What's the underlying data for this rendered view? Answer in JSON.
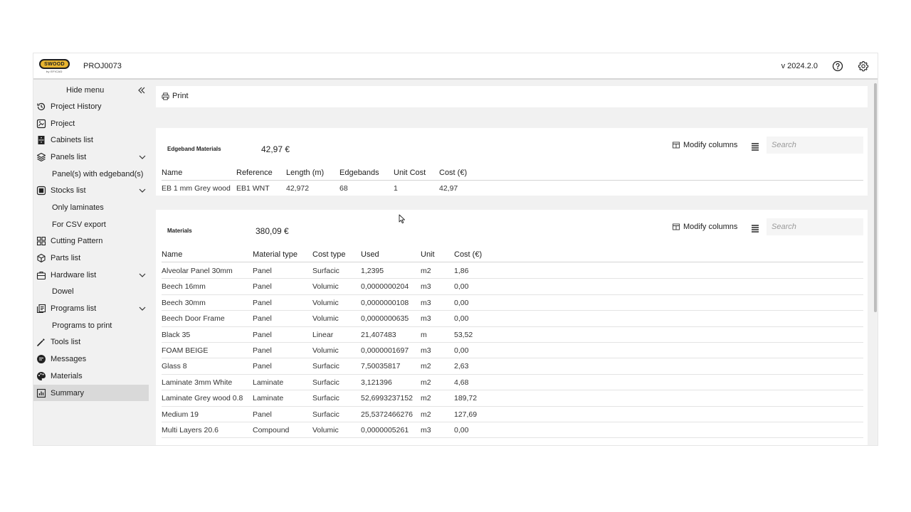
{
  "header": {
    "logo_text": "SWOOD",
    "logo_sub": "by EFICAD",
    "project_code": "PROJ0073",
    "version": "v 2024.2.0",
    "help_icon": "help-circle-icon",
    "settings_icon": "gear-icon"
  },
  "sidebar": {
    "hide_menu_label": "Hide menu",
    "items": [
      {
        "label": "Project History",
        "icon": "history-icon",
        "sub": false
      },
      {
        "label": "Project",
        "icon": "project-icon",
        "sub": false
      },
      {
        "label": "Cabinets list",
        "icon": "cabinet-icon",
        "sub": false
      },
      {
        "label": "Panels list",
        "icon": "layers-icon",
        "sub": false,
        "expandable": true
      },
      {
        "label": "Panel(s) with edgeband(s)",
        "sub": true
      },
      {
        "label": "Stocks list",
        "icon": "stock-icon",
        "sub": false,
        "expandable": true
      },
      {
        "label": "Only laminates",
        "sub": true
      },
      {
        "label": "For CSV export",
        "sub": true
      },
      {
        "label": "Cutting Pattern",
        "icon": "grid-icon",
        "sub": false
      },
      {
        "label": "Parts list",
        "icon": "cube-icon",
        "sub": false
      },
      {
        "label": "Hardware list",
        "icon": "toolbox-icon",
        "sub": false,
        "expandable": true
      },
      {
        "label": "Dowel",
        "sub": true
      },
      {
        "label": "Programs list",
        "icon": "programs-icon",
        "sub": false,
        "expandable": true
      },
      {
        "label": "Programs to print",
        "sub": true
      },
      {
        "label": "Tools list",
        "icon": "tool-icon",
        "sub": false
      },
      {
        "label": "Messages",
        "icon": "message-icon",
        "sub": false
      },
      {
        "label": "Materials",
        "icon": "palette-icon",
        "sub": false
      },
      {
        "label": "Summary",
        "icon": "chart-icon",
        "sub": false,
        "active": true
      }
    ]
  },
  "toolbar": {
    "print_label": "Print"
  },
  "edgeband": {
    "title": "Edgeband Materials",
    "total": "42,97 €",
    "modify_columns": "Modify columns",
    "search_placeholder": "Search",
    "columns": [
      "Name",
      "Reference",
      "Length (m)",
      "Edgebands",
      "Unit Cost",
      "Cost (€)"
    ],
    "rows": [
      [
        "EB 1 mm Grey wood",
        "EB1 WNT",
        "42,972",
        "68",
        "1",
        "42,97"
      ]
    ]
  },
  "materials": {
    "title": "Materials",
    "total": "380,09 €",
    "modify_columns": "Modify columns",
    "search_placeholder": "Search",
    "columns": [
      "Name",
      "Material type",
      "Cost type",
      "Used",
      "Unit",
      "Cost (€)"
    ],
    "rows": [
      [
        "Alveolar Panel 30mm",
        "Panel",
        "Surfacic",
        "1,2395",
        "m2",
        "1,86"
      ],
      [
        "Beech 16mm",
        "Panel",
        "Volumic",
        "0,0000000204",
        "m3",
        "0,00"
      ],
      [
        "Beech 30mm",
        "Panel",
        "Volumic",
        "0,0000000108",
        "m3",
        "0,00"
      ],
      [
        "Beech Door Frame",
        "Panel",
        "Volumic",
        "0,0000000635",
        "m3",
        "0,00"
      ],
      [
        "Black 35",
        "Panel",
        "Linear",
        "21,407483",
        "m",
        "53,52"
      ],
      [
        "FOAM BEIGE",
        "Panel",
        "Volumic",
        "0,0000001697",
        "m3",
        "0,00"
      ],
      [
        "Glass 8",
        "Panel",
        "Surfacic",
        "7,50035817",
        "m2",
        "2,63"
      ],
      [
        "Laminate 3mm White",
        "Laminate",
        "Surfacic",
        "3,121396",
        "m2",
        "4,68"
      ],
      [
        "Laminate Grey wood 0.8",
        "Laminate",
        "Surfacic",
        "52,6993237152",
        "m2",
        "189,72"
      ],
      [
        "Medium 19",
        "Panel",
        "Surfacic",
        "25,5372466276",
        "m2",
        "127,69"
      ],
      [
        "Multi Layers 20.6",
        "Compound",
        "Volumic",
        "0,0000005261",
        "m3",
        "0,00"
      ]
    ]
  },
  "colors": {
    "brand_yellow": "#e8b530",
    "background": "#f1f1f1",
    "active_item": "#d9d9d9"
  }
}
